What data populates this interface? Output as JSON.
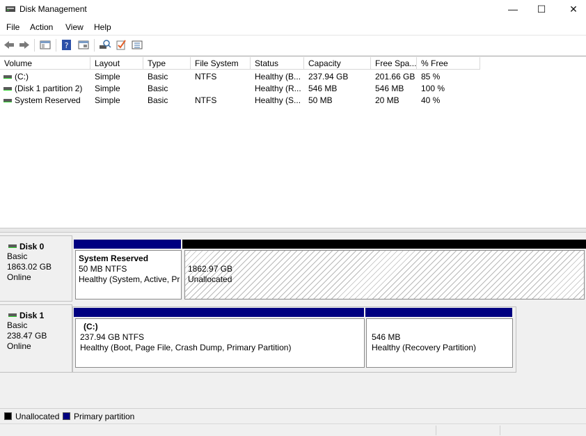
{
  "window": {
    "title": "Disk Management",
    "minimize": "—",
    "maximize": "☐",
    "close": "✕"
  },
  "menu": [
    "File",
    "Action",
    "View",
    "Help"
  ],
  "toolbar": [
    "back-icon",
    "forward-icon",
    "show-hide-console-tree-icon",
    "help-icon",
    "properties-icon",
    "rescan-disks-icon",
    "check-icon",
    "list-view-icon"
  ],
  "volume_table": {
    "columns": [
      "Volume",
      "Layout",
      "Type",
      "File System",
      "Status",
      "Capacity",
      "Free Spa...",
      "% Free"
    ],
    "rows": [
      {
        "volume": "(C:)",
        "layout": "Simple",
        "type": "Basic",
        "fs": "NTFS",
        "status": "Healthy (B...",
        "capacity": "237.94 GB",
        "free": "201.66 GB",
        "pct": "85 %"
      },
      {
        "volume": "(Disk 1 partition 2)",
        "layout": "Simple",
        "type": "Basic",
        "fs": "",
        "status": "Healthy (R...",
        "capacity": "546 MB",
        "free": "546 MB",
        "pct": "100 %"
      },
      {
        "volume": "System Reserved",
        "layout": "Simple",
        "type": "Basic",
        "fs": "NTFS",
        "status": "Healthy (S...",
        "capacity": "50 MB",
        "free": "20 MB",
        "pct": "40 %"
      }
    ]
  },
  "disks": [
    {
      "name": "Disk 0",
      "type": "Basic",
      "size": "1863.02 GB",
      "state": "Online",
      "partitions": [
        {
          "title": "System Reserved",
          "line1": "50 MB NTFS",
          "line2": "Healthy (System, Active, Pr",
          "kind": "primary"
        },
        {
          "line1": "1862.97 GB",
          "line2": "Unallocated",
          "kind": "unallocated"
        }
      ]
    },
    {
      "name": "Disk 1",
      "type": "Basic",
      "size": "238.47 GB",
      "state": "Online",
      "partitions": [
        {
          "title": "(C:)",
          "line1": "237.94 GB NTFS",
          "line2": "Healthy (Boot, Page File, Crash Dump, Primary Partition)",
          "kind": "primary"
        },
        {
          "line1": "546 MB",
          "line2": "Healthy (Recovery Partition)",
          "kind": "primary"
        }
      ]
    }
  ],
  "legend": [
    {
      "label": "Unallocated",
      "color": "#000000"
    },
    {
      "label": "Primary partition",
      "color": "#000080"
    }
  ],
  "colors": {
    "primary_band": "#000080",
    "unallocated_band": "#000000"
  }
}
